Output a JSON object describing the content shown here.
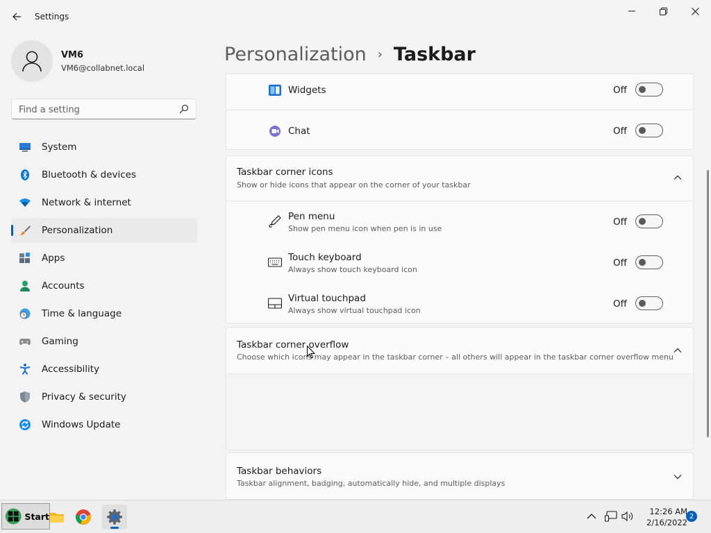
{
  "window": {
    "title": "Settings"
  },
  "profile": {
    "name": "VM6",
    "email": "VM6@collabnet.local"
  },
  "search": {
    "placeholder": "Find a setting"
  },
  "sidebar": {
    "items": [
      {
        "label": "System",
        "icon": "system-icon"
      },
      {
        "label": "Bluetooth & devices",
        "icon": "bluetooth-icon"
      },
      {
        "label": "Network & internet",
        "icon": "wifi-icon"
      },
      {
        "label": "Personalization",
        "icon": "brush-icon",
        "active": true
      },
      {
        "label": "Apps",
        "icon": "apps-icon"
      },
      {
        "label": "Accounts",
        "icon": "accounts-icon"
      },
      {
        "label": "Time & language",
        "icon": "clock-globe-icon"
      },
      {
        "label": "Gaming",
        "icon": "gamepad-icon"
      },
      {
        "label": "Accessibility",
        "icon": "accessibility-icon"
      },
      {
        "label": "Privacy & security",
        "icon": "shield-icon"
      },
      {
        "label": "Windows Update",
        "icon": "update-icon"
      }
    ]
  },
  "breadcrumb": {
    "parent": "Personalization",
    "separator": "›",
    "current": "Taskbar"
  },
  "taskbar_items": {
    "items": [
      {
        "label": "Widgets",
        "state": "Off",
        "icon": "widgets-icon"
      },
      {
        "label": "Chat",
        "state": "Off",
        "icon": "chat-icon"
      }
    ]
  },
  "corner_icons": {
    "title": "Taskbar corner icons",
    "description": "Show or hide icons that appear on the corner of your taskbar",
    "items": [
      {
        "label": "Pen menu",
        "description": "Show pen menu icon when pen is in use",
        "state": "Off",
        "icon": "pen-icon"
      },
      {
        "label": "Touch keyboard",
        "description": "Always show touch keyboard icon",
        "state": "Off",
        "icon": "keyboard-icon"
      },
      {
        "label": "Virtual touchpad",
        "description": "Always show virtual touchpad icon",
        "state": "Off",
        "icon": "touchpad-icon"
      }
    ]
  },
  "corner_overflow": {
    "title": "Taskbar corner overflow",
    "description": "Choose which icons may appear in the taskbar corner – all others will appear in the taskbar corner overflow menu"
  },
  "behaviors": {
    "title": "Taskbar behaviors",
    "description": "Taskbar alignment, badging, automatically hide, and multiple displays"
  },
  "os_taskbar": {
    "start_label": "Start",
    "time": "12:26 AM",
    "date": "2/16/2022",
    "notification_count": "2"
  },
  "colors": {
    "accent": "#005fb8",
    "background": "#f3f3f3",
    "card": "#fbfbfb"
  }
}
